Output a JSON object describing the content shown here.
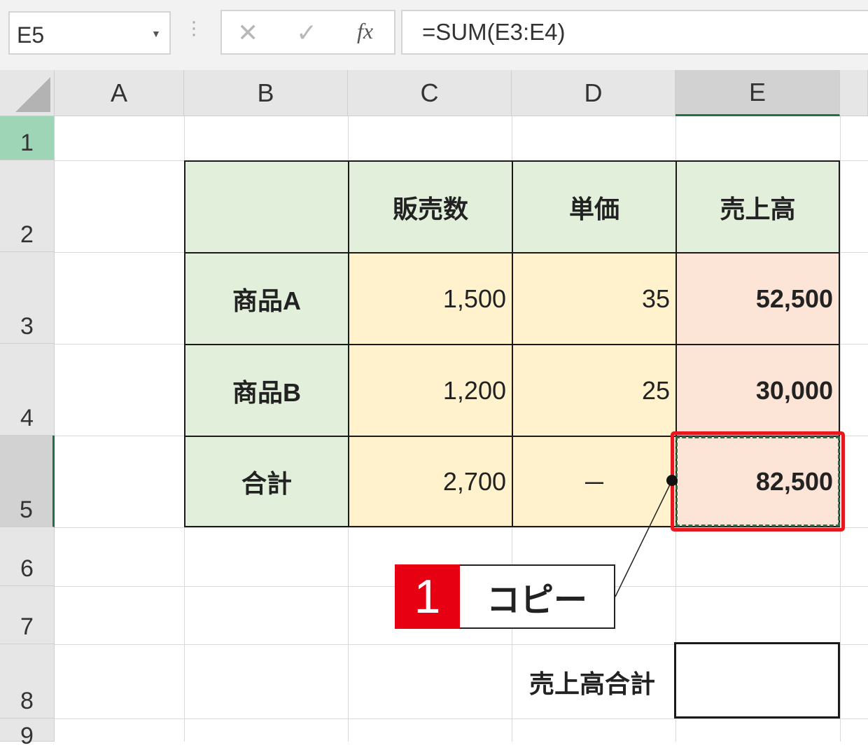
{
  "formula_bar": {
    "name_box": "E5",
    "formula": "=SUM(E3:E4)",
    "cancel_glyph": "✕",
    "enter_glyph": "✓",
    "fx_glyph": "fx",
    "icons": [
      "cancel-icon",
      "enter-icon",
      "fx-icon",
      "dropdown-icon"
    ]
  },
  "columns": [
    "A",
    "B",
    "C",
    "D",
    "E"
  ],
  "rows": [
    "1",
    "2",
    "3",
    "4",
    "5",
    "6",
    "7",
    "8",
    "9"
  ],
  "selected_cell": "E5",
  "table": {
    "headers": [
      "",
      "販売数",
      "単価",
      "売上高"
    ],
    "rows": [
      {
        "label": "商品A",
        "qty": "1,500",
        "price": "35",
        "sales": "52,500"
      },
      {
        "label": "商品B",
        "qty": "1,200",
        "price": "25",
        "sales": "30,000"
      },
      {
        "label": "合計",
        "qty": "2,700",
        "price": "－",
        "sales": "82,500"
      }
    ]
  },
  "callout": {
    "number": "1",
    "label": "コピー"
  },
  "total": {
    "label": "売上高合計",
    "value": ""
  },
  "colors": {
    "header_green": "#e2efda",
    "input_yellow": "#fff2cc",
    "result_pink": "#fce4d6",
    "highlight_red": "#e5171f",
    "excel_green": "#217346"
  }
}
